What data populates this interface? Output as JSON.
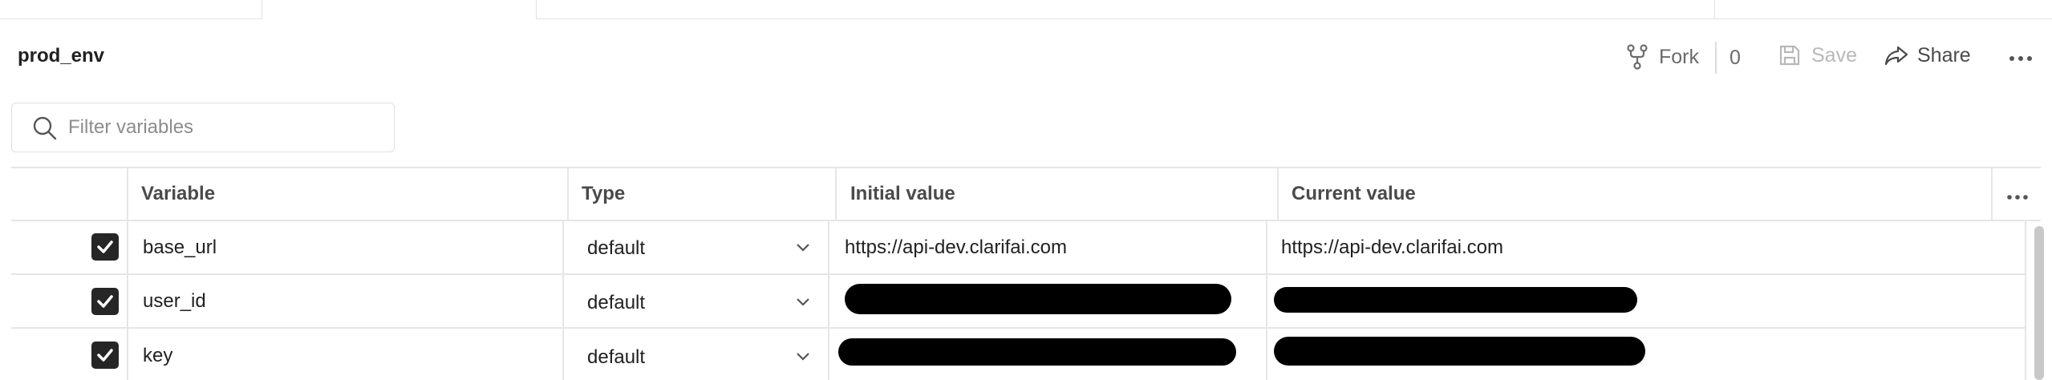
{
  "environment": {
    "name": "prod_env"
  },
  "header": {
    "fork_label": "Fork",
    "fork_count": "0",
    "save_label": "Save",
    "share_label": "Share"
  },
  "search": {
    "placeholder": "Filter variables",
    "value": ""
  },
  "table": {
    "columns": [
      "Variable",
      "Type",
      "Initial value",
      "Current value"
    ],
    "rows": [
      {
        "checked": true,
        "variable": "base_url",
        "type": "default",
        "initial_value": "https://api-dev.clarifai.com",
        "current_value": "https://api-dev.clarifai.com",
        "redacted": false
      },
      {
        "checked": true,
        "variable": "user_id",
        "type": "default",
        "initial_value": "",
        "current_value": "",
        "redacted": true
      },
      {
        "checked": true,
        "variable": "key",
        "type": "default",
        "initial_value": "",
        "current_value": "",
        "redacted": true
      }
    ]
  },
  "colors": {
    "checkbox": "#262626",
    "border": "#e6e6e6",
    "muted_text": "#6b6b6b",
    "redaction": "#000000"
  },
  "icons": [
    "fork-icon",
    "save-icon",
    "share-icon",
    "more-icon",
    "search-icon",
    "chevron-down-icon",
    "checkmark-icon"
  ]
}
